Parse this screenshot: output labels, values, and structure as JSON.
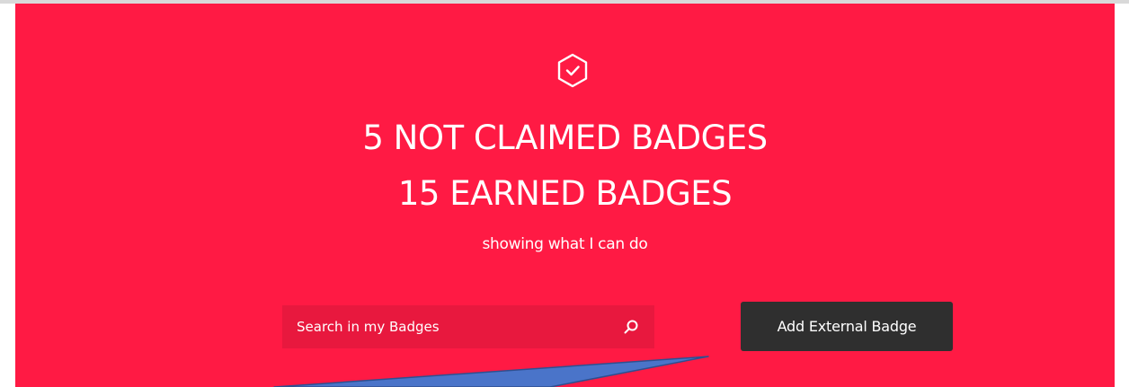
{
  "colors": {
    "hero_background": "#ff1a44",
    "search_background": "#e8183e",
    "button_background": "#2f2f2f",
    "callout_fill": "#4a74c9",
    "callout_stroke": "#2f4f8f"
  },
  "header": {
    "icon": "badge-check-hexagon-icon",
    "not_claimed": "5 NOT CLAIMED BADGES",
    "earned": "15 EARNED BADGES",
    "subtitle": "showing what I can do"
  },
  "search": {
    "placeholder": "Search in my Badges",
    "value": "",
    "icon": "search-icon"
  },
  "actions": {
    "add_external_badge": "Add External Badge"
  }
}
